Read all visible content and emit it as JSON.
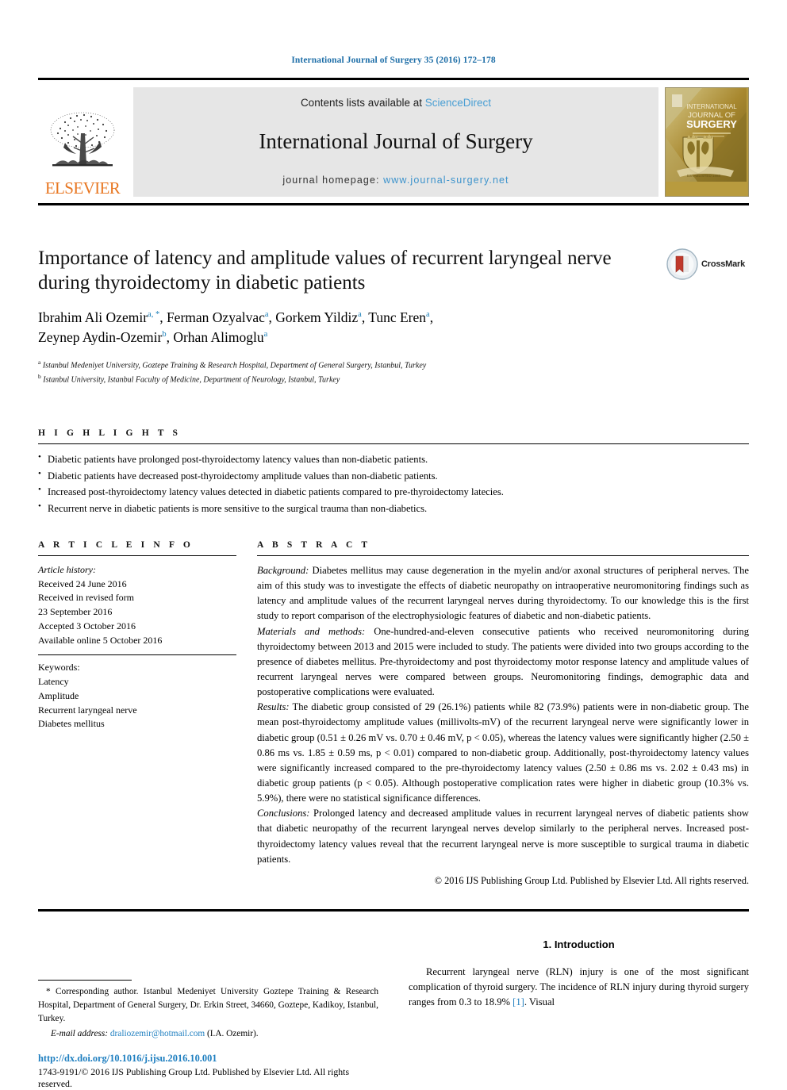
{
  "running_head": "International Journal of Surgery 35 (2016) 172–178",
  "banner": {
    "publisher_name": "ELSEVIER",
    "contents_prefix": "Contents lists available at ",
    "contents_link": "ScienceDirect",
    "journal_title": "International Journal of Surgery",
    "homepage_prefix": "journal homepage: ",
    "homepage_url": "www.journal-surgery.net",
    "cover_line1": "INTERNATIONAL",
    "cover_line2": "JOURNAL OF",
    "cover_line3": "SURGERY"
  },
  "article": {
    "title": "Importance of latency and amplitude values of recurrent laryngeal nerve during thyroidectomy in diabetic patients",
    "crossmark_label": "CrossMark",
    "authors": [
      {
        "name": "Ibrahim Ali Ozemir",
        "marks": "a, *"
      },
      {
        "name": "Ferman Ozyalvac",
        "marks": "a"
      },
      {
        "name": "Gorkem Yildiz",
        "marks": "a"
      },
      {
        "name": "Tunc Eren",
        "marks": "a"
      },
      {
        "name": "Zeynep Aydin-Ozemir",
        "marks": "b"
      },
      {
        "name": "Orhan Alimoglu",
        "marks": "a"
      }
    ],
    "affiliations": [
      {
        "mark": "a",
        "text": "Istanbul Medeniyet University, Goztepe Training & Research Hospital, Department of General Surgery, Istanbul, Turkey"
      },
      {
        "mark": "b",
        "text": "Istanbul University, Istanbul Faculty of Medicine, Department of Neurology, Istanbul, Turkey"
      }
    ]
  },
  "highlights": {
    "heading": "H I G H L I G H T S",
    "items": [
      "Diabetic patients have prolonged post-thyroidectomy latency values than non-diabetic patients.",
      "Diabetic patients have decreased post-thyroidectomy amplitude values than non-diabetic patients.",
      "Increased post-thyroidectomy latency values detected in diabetic patients compared to pre-thyroidectomy latecies.",
      "Recurrent nerve in diabetic patients is more sensitive to the surgical trauma than non-diabetics."
    ]
  },
  "article_info": {
    "heading": "A R T I C L E  I N F O",
    "history_label": "Article history:",
    "history": [
      "Received 24 June 2016",
      "Received in revised form",
      "23 September 2016",
      "Accepted 3 October 2016",
      "Available online 5 October 2016"
    ],
    "keywords_label": "Keywords:",
    "keywords": [
      "Latency",
      "Amplitude",
      "Recurrent laryngeal nerve",
      "Diabetes mellitus"
    ]
  },
  "abstract": {
    "heading": "A B S T R A C T",
    "sections": [
      {
        "label": "Background:",
        "text": " Diabetes mellitus may cause degeneration in the myelin and/or axonal structures of peripheral nerves. The aim of this study was to investigate the effects of diabetic neuropathy on intraoperative neuromonitoring findings such as latency and amplitude values of the recurrent laryngeal nerves during thyroidectomy. To our knowledge this is the first study to report comparison of the electrophysiologic features of diabetic and non-diabetic patients."
      },
      {
        "label": "Materials and methods:",
        "text": " One-hundred-and-eleven consecutive patients who received neuromonitoring during thyroidectomy between 2013 and 2015 were included to study. The patients were divided into two groups according to the presence of diabetes mellitus. Pre-thyroidectomy and post thyroidectomy motor response latency and amplitude values of recurrent laryngeal nerves were compared between groups. Neuromonitoring findings, demographic data and postoperative complications were evaluated."
      },
      {
        "label": "Results:",
        "text": " The diabetic group consisted of 29 (26.1%) patients while 82 (73.9%) patients were in non-diabetic group. The mean post-thyroidectomy amplitude values (millivolts-mV) of the recurrent laryngeal nerve were significantly lower in diabetic group (0.51 ± 0.26 mV vs. 0.70 ± 0.46 mV, p < 0.05), whereas the latency values were significantly higher (2.50 ± 0.86 ms vs. 1.85 ± 0.59 ms, p < 0.01) compared to non-diabetic group. Additionally, post-thyroidectomy latency values were significantly increased compared to the pre-thyroidectomy latency values (2.50 ± 0.86 ms vs. 2.02 ± 0.43 ms) in diabetic group patients (p < 0.05). Although postoperative complication rates were higher in diabetic group (10.3% vs. 5.9%), there were no statistical significance differences."
      },
      {
        "label": "Conclusions:",
        "text": " Prolonged latency and decreased amplitude values in recurrent laryngeal nerves of diabetic patients show that diabetic neuropathy of the recurrent laryngeal nerves develop similarly to the peripheral nerves. Increased post-thyroidectomy latency values reveal that the recurrent laryngeal nerve is more susceptible to surgical trauma in diabetic patients."
      }
    ],
    "copyright": "© 2016 IJS Publishing Group Ltd. Published by Elsevier Ltd. All rights reserved."
  },
  "footer": {
    "corresponding_marker": "*",
    "corresponding_text": " Corresponding author. Istanbul Medeniyet University Goztepe Training & Research Hospital, Department of General Surgery, Dr. Erkin Street, 34660, Goztepe, Kadikoy, Istanbul, Turkey.",
    "email_label": "E-mail address:",
    "email_address": "draliozemir@hotmail.com",
    "email_owner": "(I.A. Ozemir).",
    "doi": "http://dx.doi.org/10.1016/j.ijsu.2016.10.001",
    "issn_line": "1743-9191/© 2016 IJS Publishing Group Ltd. Published by Elsevier Ltd. All rights reserved."
  },
  "introduction": {
    "heading": "1. Introduction",
    "paragraph_part1": "Recurrent laryngeal nerve (RLN) injury is one of the most significant complication of thyroid surgery. The incidence of RLN injury during thyroid surgery ranges from 0.3 to 18.9% ",
    "reference": "[1]",
    "paragraph_part2": ". Visual"
  },
  "colors": {
    "link_blue": "#1f7fc0",
    "sciencedirect_blue": "#4a9fd4",
    "elsevier_orange": "#E87722",
    "running_head_blue": "#1f6fa8",
    "banner_gray": "#e6e6e6"
  }
}
